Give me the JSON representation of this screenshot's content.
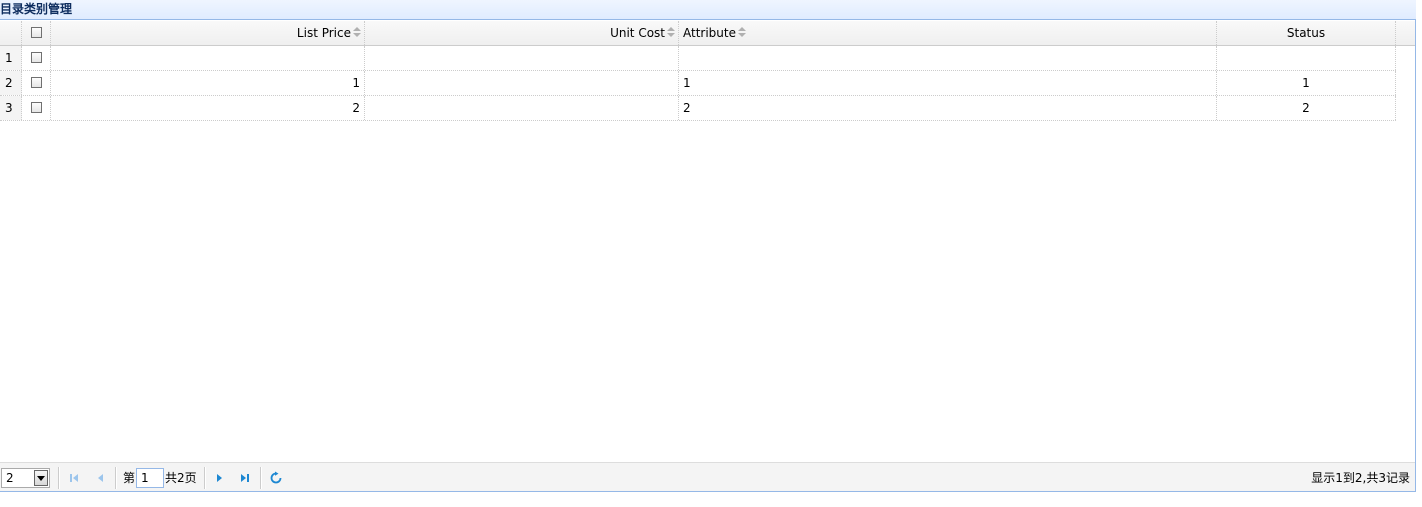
{
  "panel": {
    "title": "目录类别管理"
  },
  "columns": [
    {
      "label": "List Price"
    },
    {
      "label": "Unit Cost"
    },
    {
      "label": "Attribute"
    },
    {
      "label": "Status"
    }
  ],
  "rows": [
    {
      "num": "1",
      "list_price": "",
      "unit_cost": "",
      "attribute": "",
      "status": ""
    },
    {
      "num": "2",
      "list_price": "1",
      "unit_cost": "",
      "attribute": "1",
      "status": "1"
    },
    {
      "num": "3",
      "list_price": "2",
      "unit_cost": "",
      "attribute": "2",
      "status": "2"
    }
  ],
  "pager": {
    "page_size": "2",
    "page_prefix": "第",
    "current_page": "1",
    "total_pages_text": "共2页",
    "info": "显示1到2,共3记录"
  },
  "colors": {
    "header_border": "#95b8e7",
    "title_text": "#0e2d5f",
    "nav_icon": "#1e88d2"
  },
  "icons": {
    "first": "first-page-icon",
    "prev": "prev-page-icon",
    "next": "next-page-icon",
    "last": "last-page-icon",
    "refresh": "refresh-icon"
  }
}
